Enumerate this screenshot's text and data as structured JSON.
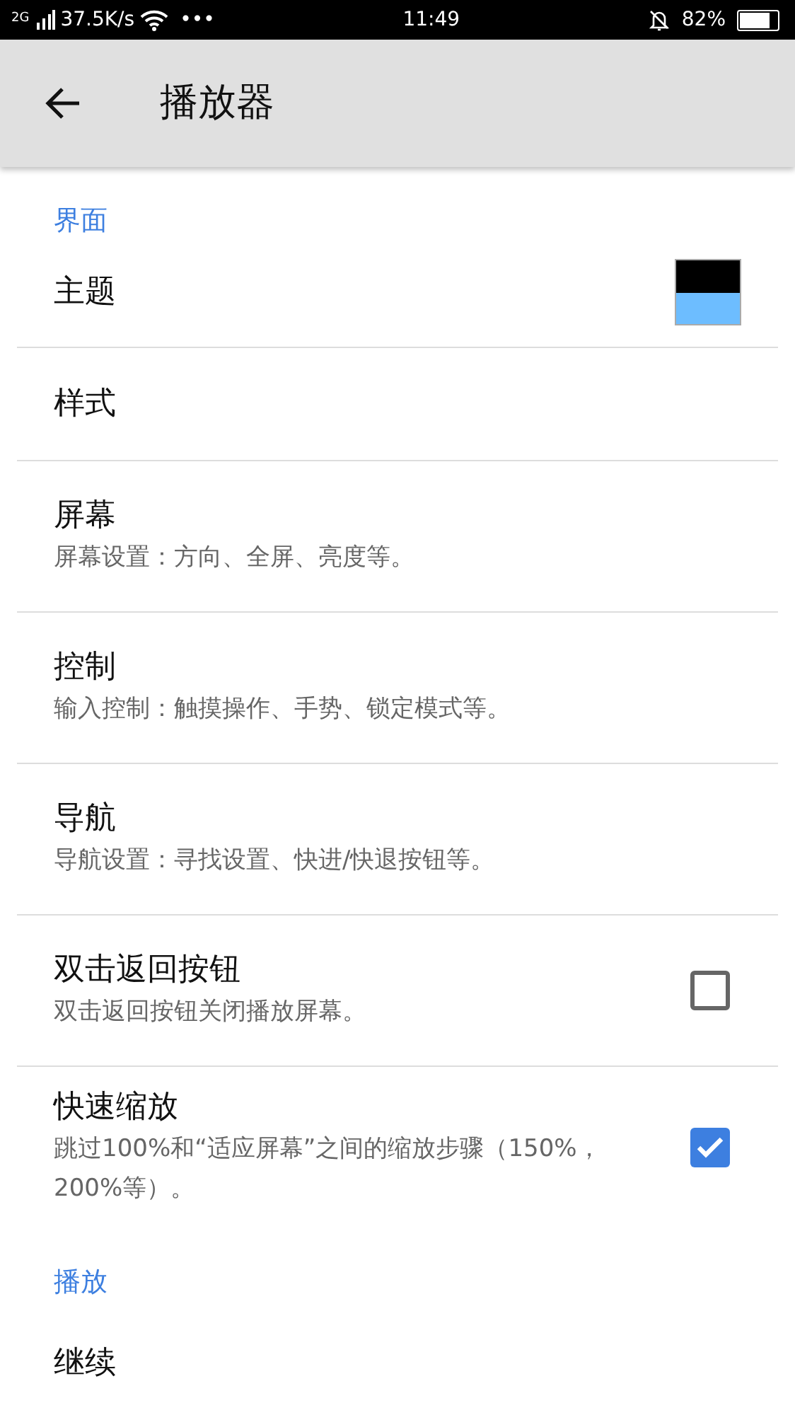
{
  "status_bar": {
    "network": "2G",
    "speed": "37.5K/s",
    "more": "•••",
    "time": "11:49",
    "battery": "82%"
  },
  "app_bar": {
    "title": "播放器"
  },
  "sections": [
    {
      "header": "界面",
      "items": [
        {
          "kind": "swatch",
          "title": "主题"
        },
        {
          "kind": "plain",
          "title": "样式"
        },
        {
          "kind": "plain",
          "title": "屏幕",
          "subtitle": "屏幕设置：方向、全屏、亮度等。"
        },
        {
          "kind": "plain",
          "title": "控制",
          "subtitle": "输入控制：触摸操作、手势、锁定模式等。"
        },
        {
          "kind": "plain",
          "title": "导航",
          "subtitle": "导航设置：寻找设置、快进/快退按钮等。"
        },
        {
          "kind": "checkbox",
          "title": "双击返回按钮",
          "subtitle": "双击返回按钮关闭播放屏幕。",
          "checked": false
        },
        {
          "kind": "checkbox",
          "title": "快速缩放",
          "subtitle": "跳过100%和“适应屏幕”之间的缩放步骤（150%，200%等）。",
          "checked": true
        }
      ]
    },
    {
      "header": "播放",
      "items": [
        {
          "kind": "plain",
          "title": "继续"
        }
      ]
    }
  ]
}
